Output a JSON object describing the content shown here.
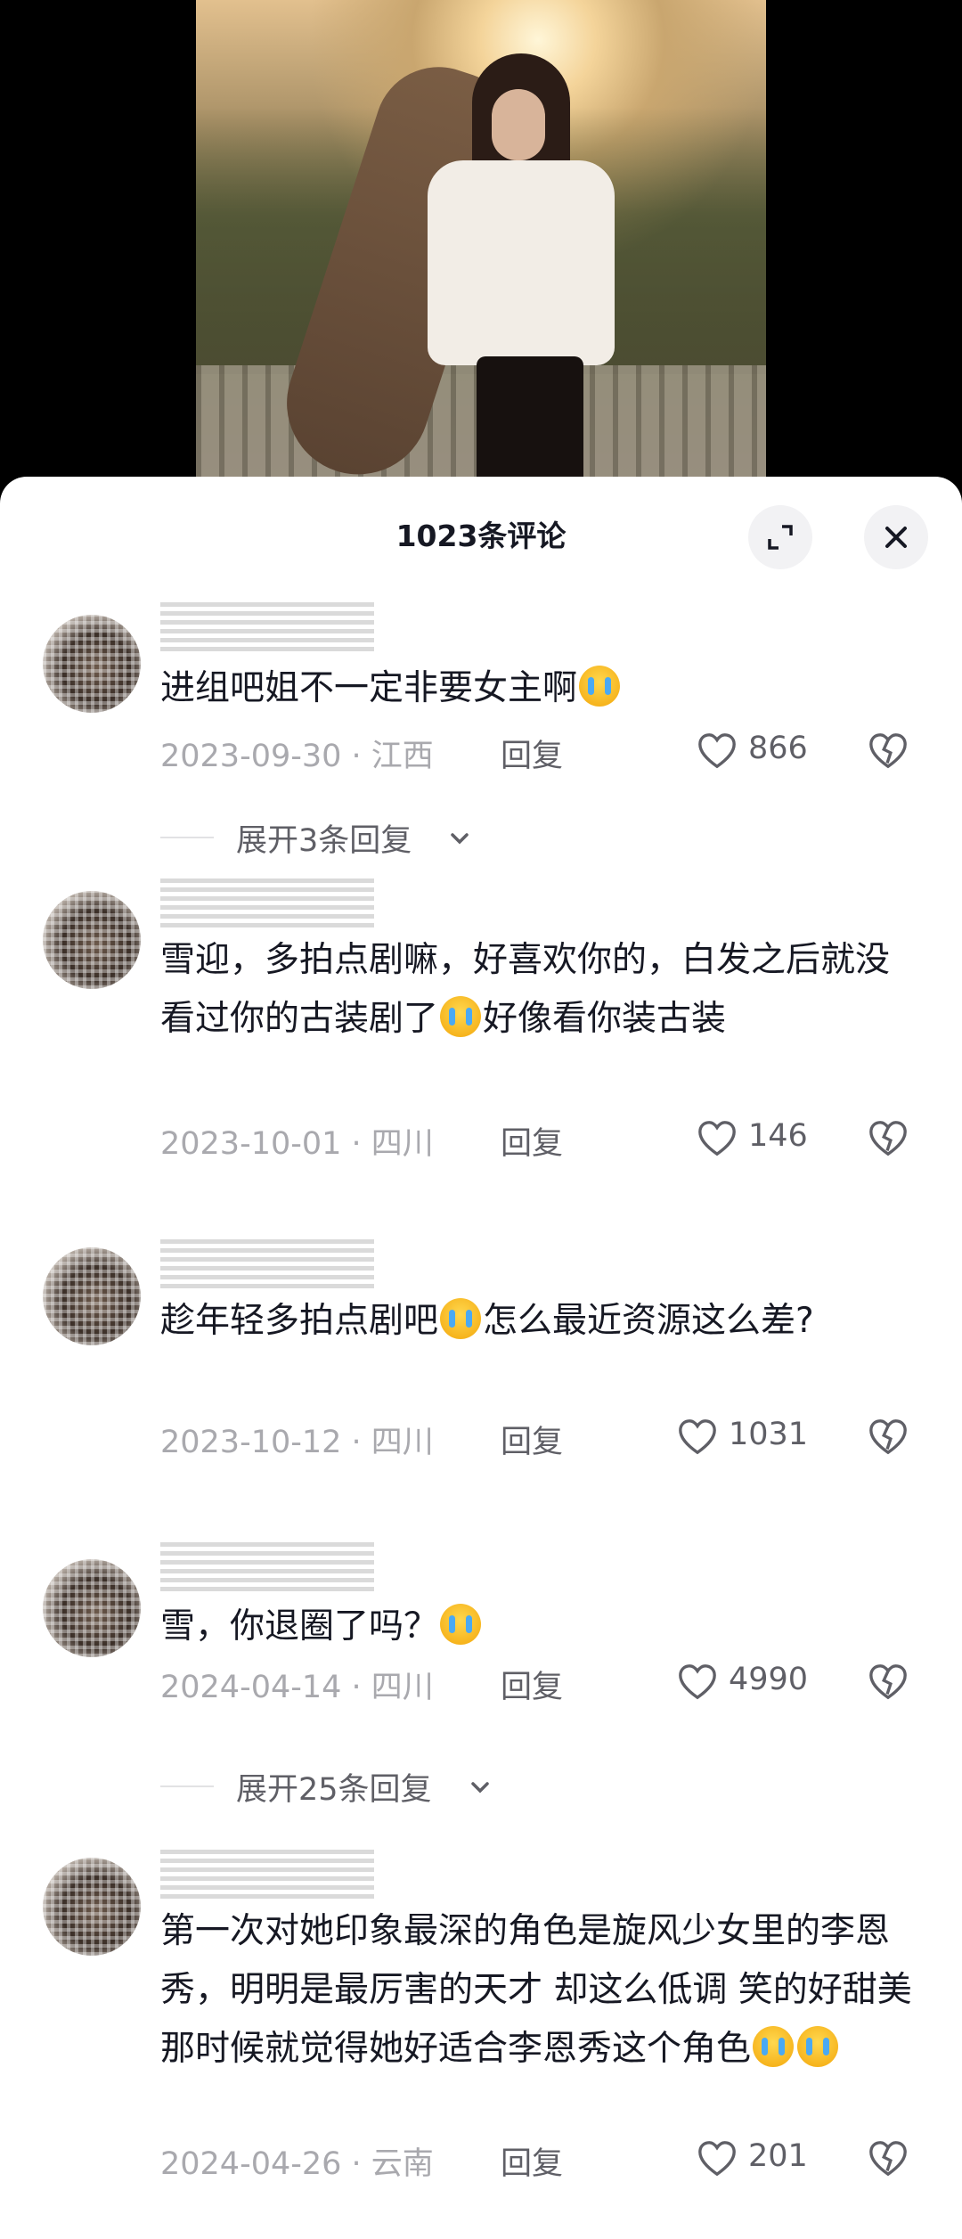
{
  "header": {
    "title": "1023条评论"
  },
  "icons": {
    "expand": "expand-icon",
    "close": "close-icon",
    "like": "heart-icon",
    "dislike": "broken-heart-icon",
    "chevron": "chevron-down-icon"
  },
  "reply_label": "回复",
  "comments": [
    {
      "text_parts": [
        "进组吧姐不一定非要女主啊",
        "[emoji]"
      ],
      "date": "2023-09-30",
      "region": "江西",
      "likes": "866",
      "expand": "展开3条回复"
    },
    {
      "text_parts": [
        "雪迎，多拍点剧嘛，好喜欢你的，白发之后就没看过你的古装剧了",
        "[emoji]",
        "好像看你装古装"
      ],
      "date": "2023-10-01",
      "region": "四川",
      "likes": "146"
    },
    {
      "text_parts": [
        "趁年轻多拍点剧吧",
        "[emoji]",
        "怎么最近资源这么差?"
      ],
      "date": "2023-10-12",
      "region": "四川",
      "likes": "1031"
    },
    {
      "text_parts": [
        "雪，你退圈了吗？",
        "[emoji]"
      ],
      "date": "2024-04-14",
      "region": "四川",
      "likes": "4990",
      "expand": "展开25条回复"
    },
    {
      "text_parts": [
        "第一次对她印象最深的角色是旋风少女里的李恩秀，明明是最厉害的天才 却这么低调 笑的好甜美 那时候就觉得她好适合李恩秀这个角色",
        "[emoji][emoji]"
      ],
      "date": "2024-04-26",
      "region": "云南",
      "likes": "201"
    }
  ]
}
